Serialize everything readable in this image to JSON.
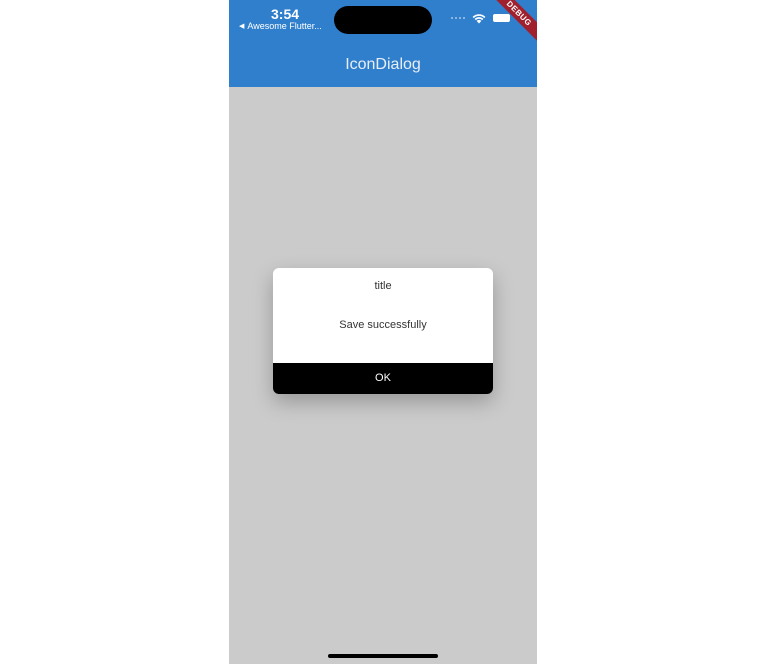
{
  "status_bar": {
    "time": "3:54",
    "back_app_label": "Awesome Flutter...",
    "back_glyph": "◀",
    "icons": [
      "signal-dots-icon",
      "wifi-icon",
      "battery-icon"
    ]
  },
  "debug_banner": {
    "label": "DEBUG",
    "color": "#a0202e"
  },
  "app_bar": {
    "title": "IconDialog",
    "color": "#2f7fcd"
  },
  "dialog": {
    "title": "title",
    "message": "Save successfully",
    "ok_label": "OK"
  },
  "colors": {
    "scrim": "#cbcbcb",
    "dialog_background": "#ffffff",
    "button_background": "#000000"
  }
}
